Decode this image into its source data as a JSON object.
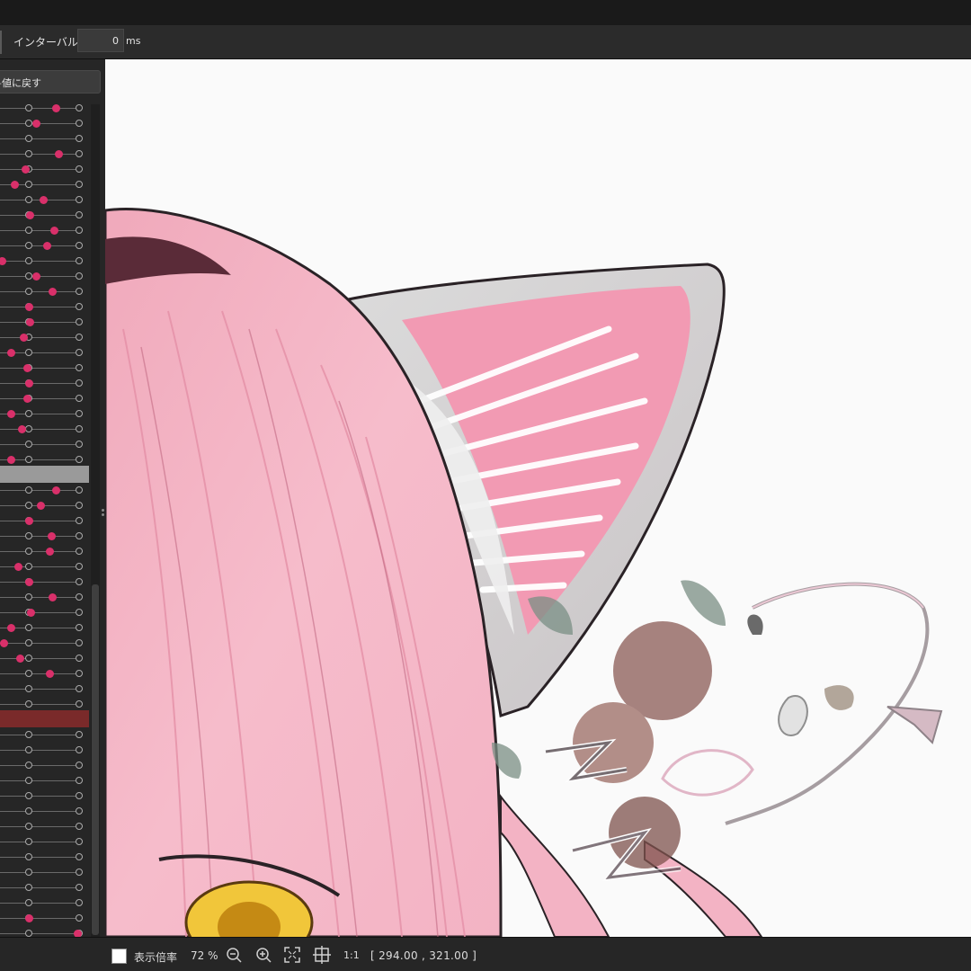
{
  "toolbar": {
    "interval_label": "インターバル：",
    "interval_value": "0",
    "interval_unit": "ms"
  },
  "sidebar": {
    "reset_label": "値に戻す"
  },
  "status": {
    "zoom_label": "表示倍率",
    "zoom_value": "72 %",
    "actual_size_label": "1:1",
    "coordinates": "[ 294.00 ,  321.00 ]"
  },
  "colors": {
    "accent_dot": "#d9306a",
    "selected_row": "#9a9a9a",
    "highlight_row": "#7a2a2a",
    "hair": "#f4b8c6",
    "ear_inner": "#f29ab3"
  },
  "icons": [
    "zoom-out-icon",
    "zoom-in-icon",
    "fit-screen-icon",
    "crosshair-icon"
  ]
}
